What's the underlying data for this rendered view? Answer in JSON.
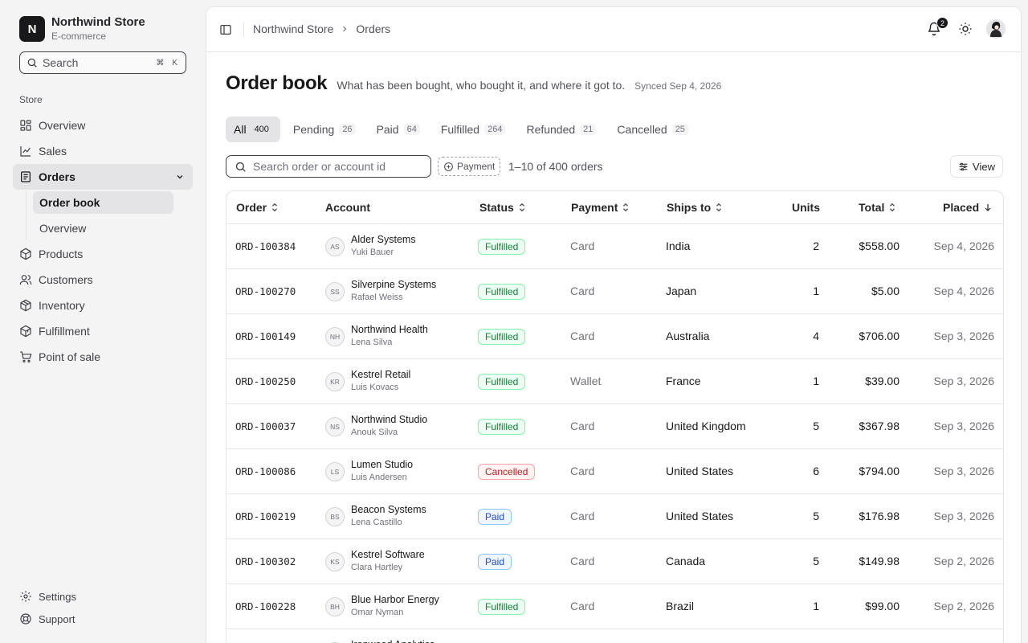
{
  "brand": {
    "initial": "N",
    "name": "Northwind Store",
    "subtitle": "E-commerce"
  },
  "sidebar": {
    "search_placeholder": "Search",
    "shortcut": [
      "⌘",
      "K"
    ],
    "group_label": "Store",
    "items": [
      {
        "label": "Overview",
        "icon": "grid-icon"
      },
      {
        "label": "Sales",
        "icon": "line-chart-icon"
      },
      {
        "label": "Orders",
        "icon": "receipt-icon",
        "active": true
      },
      {
        "label": "Products",
        "icon": "box-icon"
      },
      {
        "label": "Customers",
        "icon": "users-icon"
      },
      {
        "label": "Inventory",
        "icon": "package-icon"
      },
      {
        "label": "Fulfillment",
        "icon": "truck-icon"
      },
      {
        "label": "Point of sale",
        "icon": "cart-icon"
      }
    ],
    "order_subitems": [
      {
        "label": "Order book",
        "active": true
      },
      {
        "label": "Overview"
      }
    ],
    "footer": [
      {
        "label": "Settings",
        "icon": "gear-icon"
      },
      {
        "label": "Support",
        "icon": "lifebuoy-icon"
      }
    ]
  },
  "topbar": {
    "breadcrumb": [
      "Northwind Store",
      "Orders"
    ],
    "notifications": "2"
  },
  "page": {
    "title": "Order book",
    "subtitle": "What has been bought, who bought it, and where it got to.",
    "synced": "Synced Sep 4, 2026"
  },
  "tabs": [
    {
      "label": "All",
      "count": "400",
      "active": true
    },
    {
      "label": "Pending",
      "count": "26"
    },
    {
      "label": "Paid",
      "count": "64"
    },
    {
      "label": "Fulfilled",
      "count": "264"
    },
    {
      "label": "Refunded",
      "count": "21"
    },
    {
      "label": "Cancelled",
      "count": "25"
    }
  ],
  "toolbar": {
    "search_placeholder": "Search order or account id",
    "payment_filter": "Payment",
    "range": "1–10 of 400 orders",
    "view_label": "View"
  },
  "table": {
    "columns": {
      "order": "Order",
      "account": "Account",
      "status": "Status",
      "payment": "Payment",
      "ships_to": "Ships to",
      "units": "Units",
      "total": "Total",
      "placed": "Placed"
    },
    "rows": [
      {
        "id": "ORD-100384",
        "initials": "AS",
        "account": "Alder Systems",
        "person": "Yuki Bauer",
        "status": "Fulfilled",
        "payment": "Card",
        "ships_to": "India",
        "units": "2",
        "total": "$558.00",
        "placed": "Sep 4, 2026"
      },
      {
        "id": "ORD-100270",
        "initials": "SS",
        "account": "Silverpine Systems",
        "person": "Rafael Weiss",
        "status": "Fulfilled",
        "payment": "Card",
        "ships_to": "Japan",
        "units": "1",
        "total": "$5.00",
        "placed": "Sep 4, 2026"
      },
      {
        "id": "ORD-100149",
        "initials": "NH",
        "account": "Northwind Health",
        "person": "Lena Silva",
        "status": "Fulfilled",
        "payment": "Card",
        "ships_to": "Australia",
        "units": "4",
        "total": "$706.00",
        "placed": "Sep 3, 2026"
      },
      {
        "id": "ORD-100250",
        "initials": "KR",
        "account": "Kestrel Retail",
        "person": "Luis Kovacs",
        "status": "Fulfilled",
        "payment": "Wallet",
        "ships_to": "France",
        "units": "1",
        "total": "$39.00",
        "placed": "Sep 3, 2026"
      },
      {
        "id": "ORD-100037",
        "initials": "NS",
        "account": "Northwind Studio",
        "person": "Anouk Silva",
        "status": "Fulfilled",
        "payment": "Card",
        "ships_to": "United Kingdom",
        "units": "5",
        "total": "$367.98",
        "placed": "Sep 3, 2026"
      },
      {
        "id": "ORD-100086",
        "initials": "LS",
        "account": "Lumen Studio",
        "person": "Luis Andersen",
        "status": "Cancelled",
        "payment": "Card",
        "ships_to": "United States",
        "units": "6",
        "total": "$794.00",
        "placed": "Sep 3, 2026"
      },
      {
        "id": "ORD-100219",
        "initials": "BS",
        "account": "Beacon Systems",
        "person": "Lena Castillo",
        "status": "Paid",
        "payment": "Card",
        "ships_to": "United States",
        "units": "5",
        "total": "$176.98",
        "placed": "Sep 3, 2026"
      },
      {
        "id": "ORD-100302",
        "initials": "KS",
        "account": "Kestrel Software",
        "person": "Clara Hartley",
        "status": "Paid",
        "payment": "Card",
        "ships_to": "Canada",
        "units": "5",
        "total": "$149.98",
        "placed": "Sep 2, 2026"
      },
      {
        "id": "ORD-100228",
        "initials": "BH",
        "account": "Blue Harbor Energy",
        "person": "Omar Nyman",
        "status": "Fulfilled",
        "payment": "Card",
        "ships_to": "Brazil",
        "units": "1",
        "total": "$99.00",
        "placed": "Sep 2, 2026"
      },
      {
        "id": "",
        "initials": "",
        "account": "Ironwood Analytics",
        "person": "",
        "status": "",
        "payment": "",
        "ships_to": "",
        "units": "",
        "total": "",
        "placed": ""
      }
    ]
  }
}
